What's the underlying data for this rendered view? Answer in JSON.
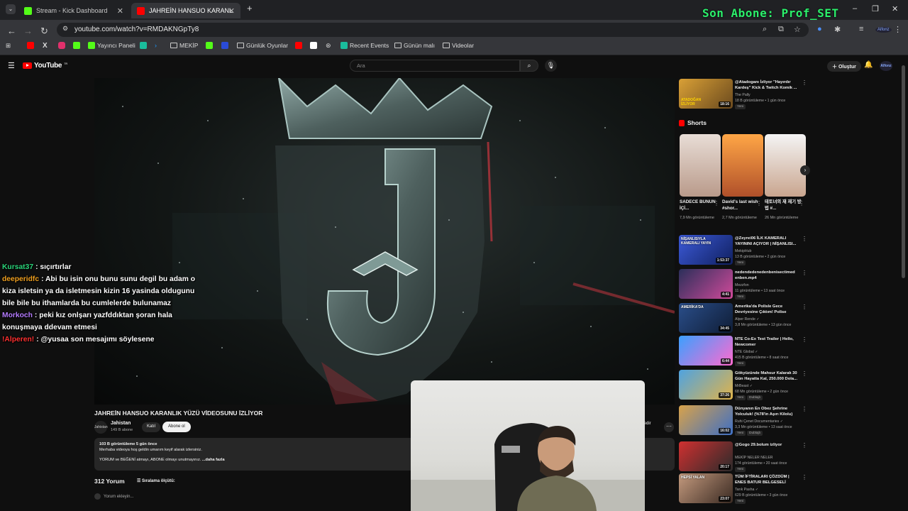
{
  "browser": {
    "tabs": [
      {
        "title": "Stream - Kick Dashboard",
        "active": false,
        "favicon_color": "#53fc18"
      },
      {
        "title": "JAHREİN HANSUO KARANLIK Y",
        "active": true,
        "favicon_color": "#ff0000"
      }
    ],
    "new_tab": "+",
    "url": "youtube.com/watch?v=RMDAKNGpTy8",
    "window_controls": [
      "–",
      "❐",
      "✕"
    ]
  },
  "overlay": {
    "last_subscriber": "Son Abone: Prof_SET"
  },
  "bookmarks": [
    {
      "label": "",
      "icon": "youtube-icon",
      "color": "#ff0000"
    },
    {
      "label": "",
      "icon": "x-icon",
      "color": "#ffffff"
    },
    {
      "label": "",
      "icon": "instagram-icon",
      "color": "#e1306c"
    },
    {
      "label": "",
      "icon": "kick-icon",
      "color": "#53fc18"
    },
    {
      "label": "Yayıncı Paneli",
      "icon": "kick-icon",
      "color": "#53fc18"
    },
    {
      "label": "",
      "icon": "app-icon",
      "color": "#1abc9c"
    },
    {
      "label": "",
      "icon": "prime-icon",
      "color": "#1a98ff"
    },
    {
      "label": "MEKİP",
      "icon": "folder-icon",
      "color": ""
    },
    {
      "label": "",
      "icon": "kick-icon",
      "color": "#53fc18"
    },
    {
      "label": "",
      "icon": "app-icon",
      "color": "#2a4bd7"
    },
    {
      "label": "Günlük Oyunlar",
      "icon": "folder-icon",
      "color": ""
    },
    {
      "label": "",
      "icon": "youtube-icon",
      "color": "#ff0000"
    },
    {
      "label": "",
      "icon": "image-icon",
      "color": "#ffffff"
    },
    {
      "label": "",
      "icon": "chatgpt-icon",
      "color": "#cccccc"
    },
    {
      "label": "Recent Events",
      "icon": "app-icon",
      "color": "#1abc9c"
    },
    {
      "label": "Günün malı",
      "icon": "folder-icon",
      "color": ""
    },
    {
      "label": "Videolar",
      "icon": "folder-icon",
      "color": ""
    }
  ],
  "youtube": {
    "logo": "YouTube",
    "logo_region": "TR",
    "search_placeholder": "Ara",
    "create_label": "Oluştur",
    "avatar_text": "Alfonz",
    "video": {
      "title": "JAHREİN HANSUO KARANLIK YÜZÜ VİDEOSUNU İZLİYOR",
      "channel": "Jahistan",
      "channel_avatar_text": "Jahistan",
      "subscribers": "149 B abone",
      "join_label": "Katıl",
      "subscribe_label": "Abone ol",
      "share_label": "İedir",
      "description_meta": "103 B görüntüleme  5 gün önce",
      "description_line1": "Merhaba videoya hoş geldin umarım keyif alarak izlersiniz.",
      "description_line2": "YORUM ve BEĞENİ atmayı, ABONE olmayı unutmayınız.",
      "description_more": "...daha fazla",
      "comment_count": "312 Yorum",
      "sort_label": "Sıralama ölçütü:",
      "add_comment": "Yorum ekleyin..."
    },
    "top_video": {
      "title": "@Atadoganı İzliyor \"Hayırdır Kardeş\" Kick & Twitch Komik ...",
      "channel": "The Pally",
      "views": "18 B görüntüleme • 1 gün önce",
      "badge": "Yeni",
      "duration": "18:16"
    },
    "shorts_heading": "Shorts",
    "shorts": [
      {
        "title": "SADECE BUNUN İÇİ...",
        "views": "7,9 Mn görüntüleme"
      },
      {
        "title": "David's last wish #shor...",
        "views": "2,7 Mn görüntüleme"
      },
      {
        "title": "테토녀의 재 재기 방법 #...",
        "views": "26 Mn görüntüleme"
      }
    ],
    "recommendations": [
      {
        "title": "@Zeyrei06 İLK KAMERALI YAYININI AÇIYOR | NİŞANLISI...",
        "channel": "MekipHub",
        "views": "13 B görüntüleme • 2 gün önce",
        "badge": "Yeni",
        "dubbed": "",
        "duration": "1:53:37"
      },
      {
        "title": "nedendedenedenbenisectimed enben.mp4",
        "channel": "Mezzfon",
        "views": "11 görüntüleme • 13 saat önce",
        "badge": "Yeni",
        "dubbed": "",
        "duration": "4:41"
      },
      {
        "title": "Amerika'da Polisle Gece Devriyesine Çıktım! Polise Küf...",
        "channel": "Alper Rende ✓",
        "views": "3,8 Mn görüntüleme • 13 gün önce",
        "badge": "",
        "dubbed": "",
        "duration": "34:45"
      },
      {
        "title": "NTE Co-Ex Test Trailer | Hello, Newcomer",
        "channel": "NTE Global ✓",
        "views": "415 B görüntüleme • 8 saat önce",
        "badge": "Yeni",
        "dubbed": "",
        "duration": "6:44"
      },
      {
        "title": "Gökyüzünde Mahsur Kalarak 30 Gün Hayatta Kal, 250.000 Dola...",
        "channel": "MrBeast ✓",
        "views": "68 Mn görüntüleme • 2 gün önce",
        "badge": "Yeni",
        "dubbed": "Dublajlı",
        "duration": "37:26"
      },
      {
        "title": "Dünyanın En Obez Şehrine Yolculuk! (%78'in Aşırı Kilolu)",
        "channel": "Ruhi Çenet Documentaries ✓",
        "views": "3,3 Mn görüntüleme • 13 saat önce",
        "badge": "Yeni",
        "dubbed": "Dublajlı",
        "duration": "16:02"
      },
      {
        "title": "@Gogo 29.bolum izliyor",
        "channel": "MEKİP NELER NELER",
        "views": "174 görüntüleme • 20 saat önce",
        "badge": "Yeni",
        "dubbed": "",
        "duration": "20:17"
      },
      {
        "title": "TÜM İFTİRALARI ÇÖZDÜM | ENES BATUR BELGESELİ",
        "channel": "Tarık Pasha ✓",
        "views": "629 B görüntüleme • 3 gün önce",
        "badge": "Yeni",
        "dubbed": "",
        "duration": "23:07"
      }
    ],
    "thumb_text": {
      "top": "ATADOĞAN İZLİYOR",
      "zeyrei": "NİŞANLISIYLA KAMERALI YAYIN",
      "amerika": "AMERİKA'DA",
      "enes": "HEPSİ YALAN"
    }
  },
  "chat": [
    {
      "user": "Kursat37",
      "color": "#2bd67b",
      "message": "sıçırtırlar"
    },
    {
      "user": "deeperidfc",
      "color": "#f0a020",
      "message": "Abi bu isin onu bunu sunu degil bu adam o kiza isletsin ya da isletmesin kizin 16 yasinda oldugunu bile bile bu ithamlarda bu cumlelerde bulunamaz"
    },
    {
      "user": "Morkoch",
      "color": "#b57cff",
      "message": "peki kız onlşarı yazfddıktan şoran hala konuşmaya ddevam etmesi"
    },
    {
      "user": "!Alperen!",
      "color": "#ff3030",
      "message": "@yusaa son mesajımı söylesene"
    }
  ]
}
